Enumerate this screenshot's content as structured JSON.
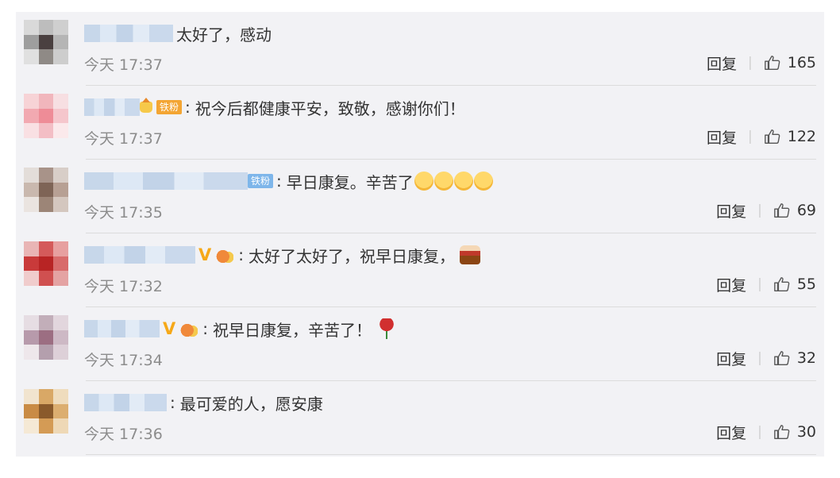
{
  "comments": [
    {
      "text": "太好了，感动",
      "time": "今天 17:37",
      "reply_label": "回复",
      "like_count": "165",
      "avatar_colors": [
        "#d9d9d9",
        "#bdbdbd",
        "#cfcfcf",
        "#9e9e9e",
        "#4a4040",
        "#b5b5b5",
        "#e0e0e0",
        "#8f8a86",
        "#cdcdcd"
      ]
    },
    {
      "badge": "铁粉",
      "text": "祝今后都健康平安，致敬，感谢你们！",
      "time": "今天 17:37",
      "reply_label": "回复",
      "like_count": "122",
      "avatar_colors": [
        "#f7d3d6",
        "#f1b6bc",
        "#f7dfe2",
        "#f2a9b1",
        "#ee8c97",
        "#f5c6cc",
        "#f9e0e3",
        "#f3bec5",
        "#fbe9eb"
      ]
    },
    {
      "badge": "铁粉",
      "text": "早日康复。辛苦了",
      "time": "今天 17:35",
      "reply_label": "回复",
      "like_count": "69",
      "avatar_colors": [
        "#e3ddd9",
        "#a89389",
        "#d8cec8",
        "#c9b8ae",
        "#7e6456",
        "#b7a094",
        "#eae4e0",
        "#9c8577",
        "#d4c7bf"
      ]
    },
    {
      "text": "太好了太好了，祝早日康复，",
      "time": "今天 17:32",
      "reply_label": "回复",
      "like_count": "55",
      "avatar_colors": [
        "#e9b5b5",
        "#d45a5a",
        "#e7a0a0",
        "#c93a3a",
        "#b82424",
        "#d86b6b",
        "#f0cccc",
        "#d05050",
        "#e4a3a3"
      ]
    },
    {
      "text": "祝早日康复，辛苦了！",
      "time": "今天 17:34",
      "reply_label": "回复",
      "like_count": "32",
      "avatar_colors": [
        "#e6dde3",
        "#c2aeb9",
        "#e2d6dd",
        "#b79aab",
        "#9c6e82",
        "#cdb9c5",
        "#eee7eb",
        "#b49fad",
        "#ddd0d8"
      ]
    },
    {
      "text": "最可爱的人，愿安康",
      "time": "今天 17:36",
      "reply_label": "回复",
      "like_count": "30",
      "avatar_colors": [
        "#f1e4cf",
        "#d9a866",
        "#efdcbd",
        "#c98b45",
        "#8a5a2b",
        "#dcae70",
        "#f5e9d5",
        "#d49b55",
        "#eed8b6"
      ]
    }
  ],
  "icons": {
    "like": "thumbs-up-outline-icon",
    "emoji_face": "tearful-face-icon",
    "emoji_cake": "birthday-cake-icon",
    "emoji_rose": "rose-icon"
  },
  "colors": {
    "background": "#f2f2f5",
    "time_text": "#8c8c8c",
    "fan_badge_orange": "#f3a533",
    "fan_badge_blue": "#7eb6ea"
  }
}
